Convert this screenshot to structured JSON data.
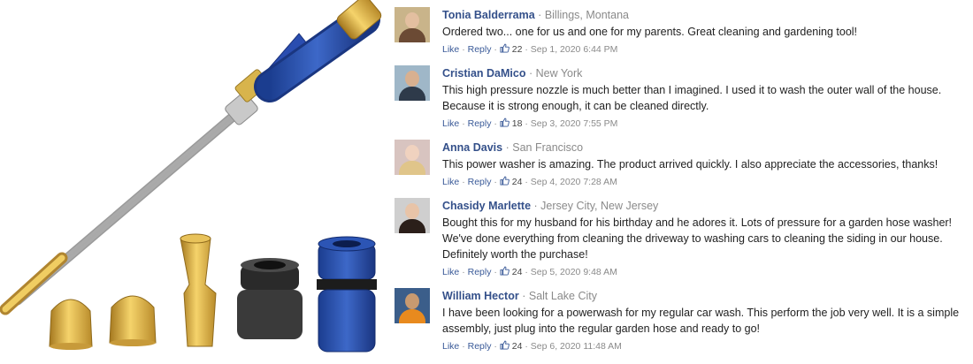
{
  "colors": {
    "author": "#34508a",
    "link": "#3a5a98",
    "muted": "#8a8a8a",
    "text": "#222222"
  },
  "actions": {
    "like": "Like",
    "reply": "Reply",
    "separator": "·",
    "like_icon": "thumbs-up-icon"
  },
  "product": {
    "image": "pressure-washer-wand-with-nozzles-and-hose-connectors"
  },
  "comments": [
    {
      "author": "Tonia Balderrama",
      "location": "Billings, Montana",
      "text": "Ordered two... one for us and one for my parents. Great cleaning and gardening tool!",
      "likes": "22",
      "date": "Sep 1, 2020 6:44 PM",
      "avatar": "woman-in-car-avatar"
    },
    {
      "author": "Cristian DaMico",
      "location": "New York",
      "text": "This high pressure nozzle is much better than I imagined. I used it to wash the outer wall of the house. Because it is strong enough, it can be cleaned directly.",
      "likes": "18",
      "date": "Sep 3, 2020 7:55 PM",
      "avatar": "man-outdoors-avatar"
    },
    {
      "author": "Anna Davis",
      "location": "San Francisco",
      "text": "This power washer is amazing. The product arrived quickly. I also appreciate the accessories, thanks!",
      "likes": "24",
      "date": "Sep 4, 2020 7:28 AM",
      "avatar": "blonde-woman-avatar"
    },
    {
      "author": "Chasidy Marlette",
      "location": "Jersey City, New Jersey",
      "text": "Bought this for my husband for his birthday and he adores it. Lots of pressure for a garden hose washer! We've done everything from cleaning the driveway to washing cars to cleaning the siding in our house. Definitely worth the purchase!",
      "likes": "24",
      "date": "Sep 5, 2020 9:48 AM",
      "avatar": "brunette-woman-avatar"
    },
    {
      "author": "William Hector",
      "location": "Salt Lake City",
      "text": "I have been looking for a powerwash for my regular car wash. This perform the job very well. It is a simple assembly, just plug into the regular garden hose and ready to go!",
      "likes": "24",
      "date": "Sep 6, 2020 11:48 AM",
      "avatar": "man-in-orange-vest-avatar"
    }
  ]
}
